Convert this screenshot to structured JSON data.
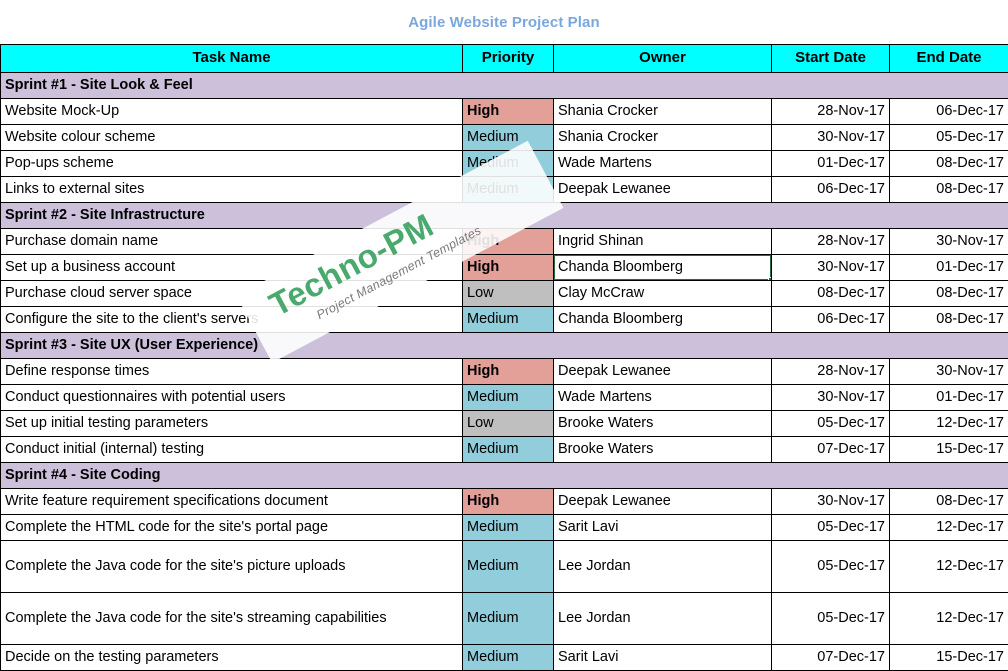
{
  "document": {
    "title": "Agile Website Project Plan"
  },
  "colors": {
    "title_text": "#7ba7dd",
    "header_fill": "#00ffff",
    "sprint_fill": "#ccc0da",
    "priority_high_fill": "#e3a099",
    "priority_medium_fill": "#92cddc",
    "priority_low_fill": "#bfbfbf",
    "selection_border": "#2a6b45",
    "watermark_main": "#4aa96c",
    "watermark_sub": "#7a7a7a"
  },
  "table": {
    "columns": [
      {
        "key": "task",
        "label": "Task Name",
        "align": "left"
      },
      {
        "key": "priority",
        "label": "Priority",
        "align": "left"
      },
      {
        "key": "owner",
        "label": "Owner",
        "align": "left"
      },
      {
        "key": "start",
        "label": "Start Date",
        "align": "right"
      },
      {
        "key": "end",
        "label": "End Date",
        "align": "right"
      }
    ],
    "groups": [
      {
        "label": "Sprint #1 - Site Look & Feel",
        "rows": [
          {
            "task": "Website Mock-Up",
            "priority": "High",
            "owner": "Shania Crocker",
            "start": "28-Nov-17",
            "end": "06-Dec-17"
          },
          {
            "task": "Website colour scheme",
            "priority": "Medium",
            "owner": "Shania Crocker",
            "start": "30-Nov-17",
            "end": "05-Dec-17"
          },
          {
            "task": "Pop-ups scheme",
            "priority": "Medium",
            "owner": "Wade Martens",
            "start": "01-Dec-17",
            "end": "08-Dec-17"
          },
          {
            "task": "Links to external sites",
            "priority": "Medium",
            "owner": "Deepak Lewanee",
            "start": "06-Dec-17",
            "end": "08-Dec-17"
          }
        ]
      },
      {
        "label": "Sprint #2 - Site Infrastructure",
        "rows": [
          {
            "task": "Purchase domain name",
            "priority": "High",
            "owner": "Ingrid Shinan",
            "start": "28-Nov-17",
            "end": "30-Nov-17"
          },
          {
            "task": "Set up a business account",
            "priority": "High",
            "owner": "Chanda Bloomberg",
            "start": "30-Nov-17",
            "end": "01-Dec-17",
            "owner_selected": true
          },
          {
            "task": "Purchase cloud server space",
            "priority": "Low",
            "owner": "Clay McCraw",
            "start": "08-Dec-17",
            "end": "08-Dec-17"
          },
          {
            "task": "Configure the site to the client's servers",
            "priority": "Medium",
            "owner": "Chanda Bloomberg",
            "start": "06-Dec-17",
            "end": "08-Dec-17"
          }
        ]
      },
      {
        "label": "Sprint #3 - Site UX (User Experience)",
        "rows": [
          {
            "task": "Define response times",
            "priority": "High",
            "owner": "Deepak Lewanee",
            "start": "28-Nov-17",
            "end": "30-Nov-17"
          },
          {
            "task": "Conduct questionnaires with potential users",
            "priority": "Medium",
            "owner": "Wade Martens",
            "start": "30-Nov-17",
            "end": "01-Dec-17"
          },
          {
            "task": "Set up initial testing parameters",
            "priority": "Low",
            "owner": "Brooke Waters",
            "start": "05-Dec-17",
            "end": "12-Dec-17"
          },
          {
            "task": "Conduct initial (internal) testing",
            "priority": "Medium",
            "owner": "Brooke Waters",
            "start": "07-Dec-17",
            "end": "15-Dec-17"
          }
        ]
      },
      {
        "label": "Sprint #4 - Site Coding",
        "rows": [
          {
            "task": "Write feature requirement specifications document",
            "priority": "High",
            "owner": "Deepak Lewanee",
            "start": "30-Nov-17",
            "end": "08-Dec-17"
          },
          {
            "task": "Complete the HTML code for the site's portal page",
            "priority": "Medium",
            "owner": "Sarit Lavi",
            "start": "05-Dec-17",
            "end": "12-Dec-17"
          },
          {
            "task": "Complete the Java code for the site's picture uploads",
            "priority": "Medium",
            "owner": "Lee Jordan",
            "start": "05-Dec-17",
            "end": "12-Dec-17",
            "tall": true
          },
          {
            "task": "Complete the Java code for the site's streaming capabilities",
            "priority": "Medium",
            "owner": "Lee Jordan",
            "start": "05-Dec-17",
            "end": "12-Dec-17",
            "tall": true
          },
          {
            "task": "Decide on the testing parameters",
            "priority": "Medium",
            "owner": "Sarit Lavi",
            "start": "07-Dec-17",
            "end": "15-Dec-17"
          }
        ]
      }
    ]
  },
  "watermark": {
    "main": "Techno-PM",
    "sub": "Project Management Templates"
  }
}
